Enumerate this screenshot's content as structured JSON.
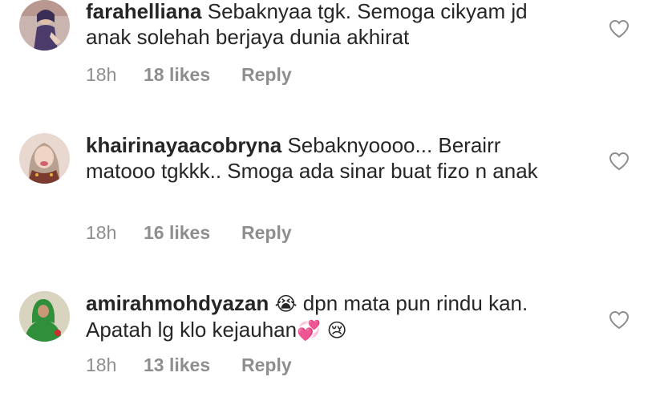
{
  "comments": [
    {
      "username": "farahelliana",
      "text": "Sebaknyaa tgk. Semoga cikyam jd anak solehah berjaya dunia akhirat",
      "emoji_after": "",
      "text2": "",
      "emoji_end": "",
      "time": "18h",
      "likes": "18 likes",
      "reply": "Reply",
      "avatar_colors": {
        "bg": "#c9b4b0",
        "body": "#4a3b6b"
      }
    },
    {
      "username": "khairinayaacobryna",
      "text": "Sebaknyoooo... Berairr matooo tgkkk.. Smoga ada sinar buat fizo n anak",
      "emoji_after": "",
      "text2": "",
      "emoji_end": "",
      "time": "18h",
      "likes": "16 likes",
      "reply": "Reply",
      "avatar_colors": {
        "bg": "#e8d8d0",
        "body": "#7a3a2e"
      }
    },
    {
      "username": "amirahmohdyazan",
      "text": "",
      "emoji_after": "😭",
      "text2": " dpn mata pun rindu kan. Apatah lg klo kejauhan",
      "emoji_end": "💞 😢",
      "time": "18h",
      "likes": "13 likes",
      "reply": "Reply",
      "avatar_colors": {
        "bg": "#c8c8b8",
        "body": "#2f8f3a"
      }
    }
  ],
  "icons": {
    "like": "heart-outline-icon"
  },
  "colors": {
    "text": "#262626",
    "meta": "#8e8e8e"
  }
}
